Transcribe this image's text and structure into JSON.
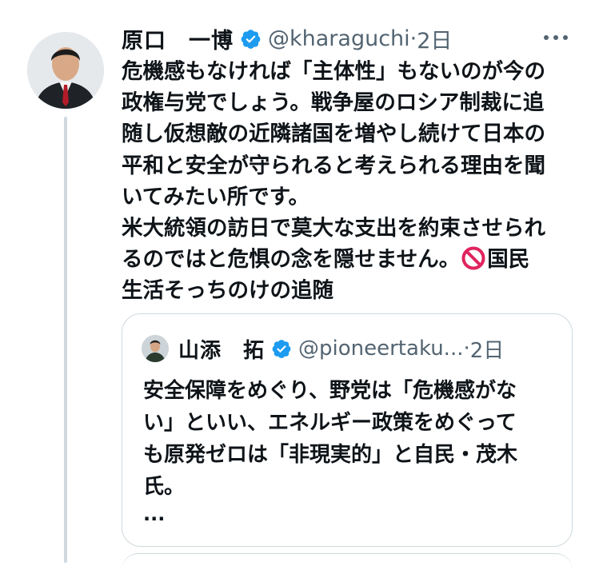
{
  "tweet": {
    "author_name": "原口　一博",
    "handle": "@kharaguchi",
    "separator": "·",
    "time": "2日",
    "body_lines": [
      "危機感もなければ「主体性」もないのが今の",
      "政権与党でしょう。戦争屋のロシア制裁に追",
      "随し仮想敵の近隣諸国を増やし続けて日本の",
      "平和と安全が守られると考えられる理由を聞",
      "いてみたい所です。",
      "米大統領の訪日で莫大な支出を約束させられ",
      "るのではと危惧の念を隠せません。",
      "国民",
      "生活そっちのけの追随"
    ]
  },
  "quote": {
    "author_name": "山添　拓",
    "handle": "@pioneertaku...",
    "separator": "·",
    "time": "2日",
    "body_lines": [
      "安全保障をめぐり、野党は「危機感がな",
      "い」といい、エネルギー政策をめぐって",
      "も原発ゼロは「非現実的」と自民・茂木",
      "氏。"
    ],
    "ellipsis": "..."
  },
  "colors": {
    "verified": "#1d9bf0",
    "secondary_text": "#536471",
    "border": "#cfd9de",
    "no_entry": "#e0245e"
  },
  "icons": {
    "verified": "verified-badge-icon",
    "more": "more-dots-icon",
    "no_entry": "no-entry-emoji-icon"
  }
}
